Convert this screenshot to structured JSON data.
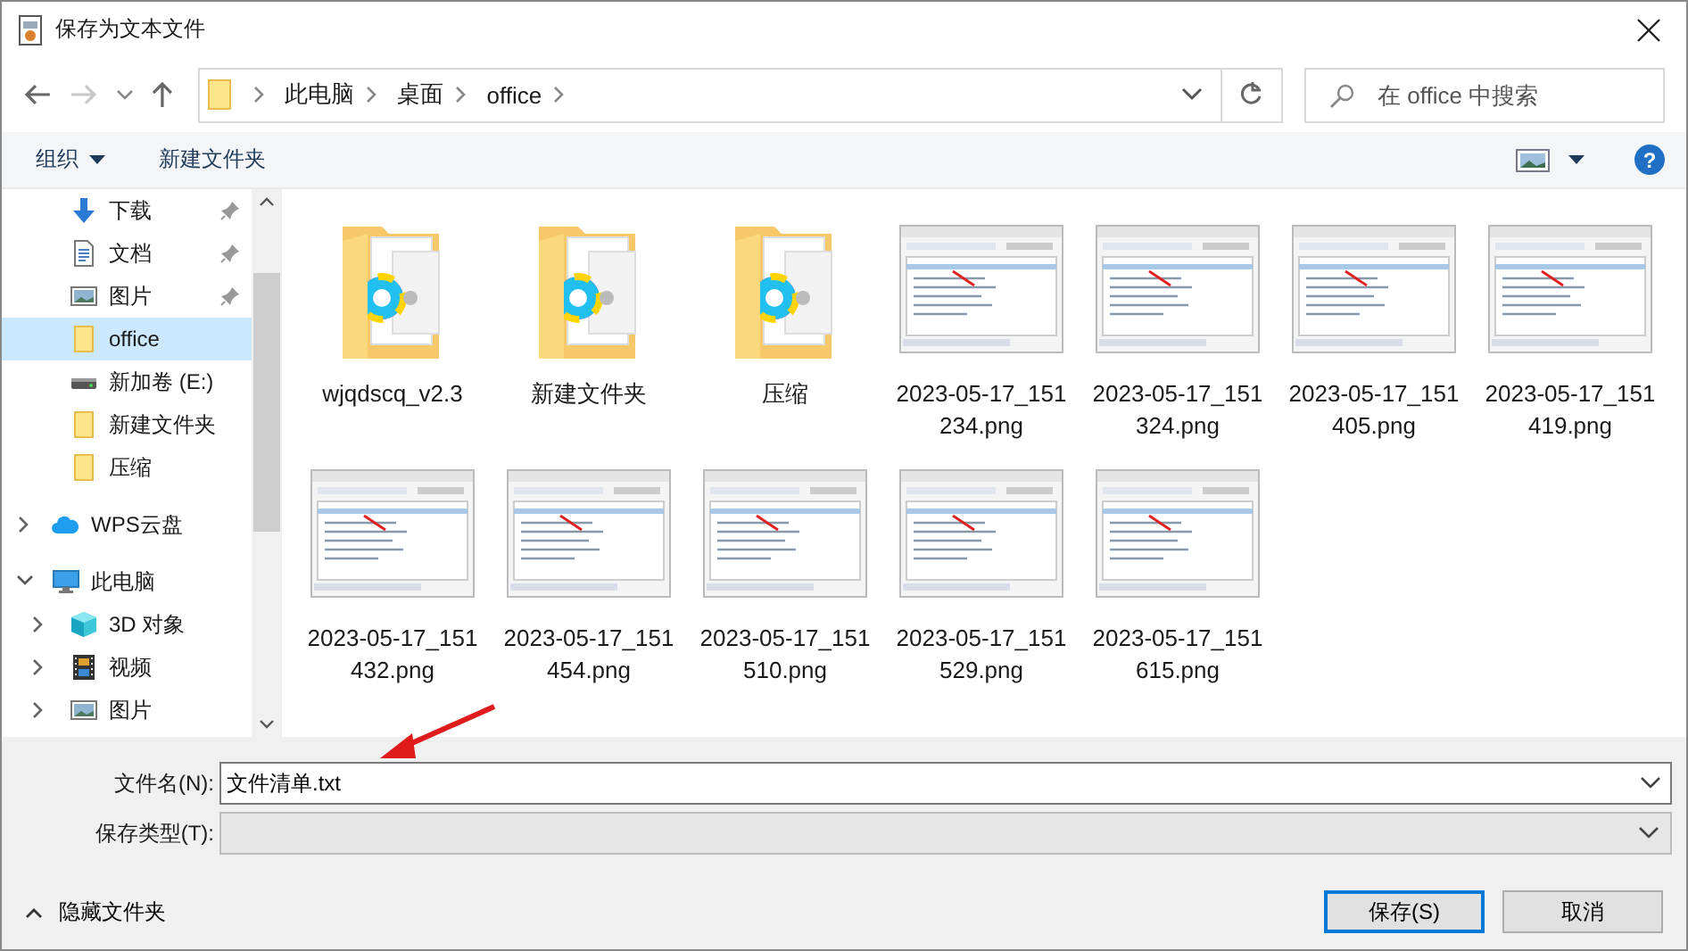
{
  "window": {
    "title": "保存为文本文件"
  },
  "navigation": {
    "back_disabled": false,
    "forward_disabled": true
  },
  "address": {
    "crumbs": [
      "此电脑",
      "桌面",
      "office"
    ]
  },
  "search": {
    "placeholder": "在 office 中搜索"
  },
  "toolbar": {
    "organize": "组织",
    "new_folder": "新建文件夹",
    "help": "?"
  },
  "sidebar": {
    "pinned_items": [
      {
        "label": "下载",
        "kind": "download",
        "pinned": true,
        "selected": false
      },
      {
        "label": "文档",
        "kind": "document",
        "pinned": true,
        "selected": false
      },
      {
        "label": "图片",
        "kind": "picture",
        "pinned": true,
        "selected": false
      },
      {
        "label": "office",
        "kind": "folder",
        "pinned": false,
        "selected": true
      },
      {
        "label": "新加卷 (E:)",
        "kind": "drive",
        "pinned": false,
        "selected": false
      },
      {
        "label": "新建文件夹",
        "kind": "folder",
        "pinned": false,
        "selected": false
      },
      {
        "label": "压缩",
        "kind": "folder",
        "pinned": false,
        "selected": false
      }
    ],
    "roots": [
      {
        "label": "WPS云盘",
        "kind": "cloud",
        "expanded": false,
        "selected": false
      },
      {
        "label": "此电脑",
        "kind": "monitor",
        "expanded": true,
        "selected": false,
        "children": [
          {
            "label": "3D 对象",
            "kind": "cube",
            "expanded": false,
            "selected": false
          },
          {
            "label": "视频",
            "kind": "film",
            "expanded": false,
            "selected": false
          },
          {
            "label": "图片",
            "kind": "picture",
            "expanded": false,
            "selected": false
          }
        ]
      }
    ]
  },
  "files": [
    {
      "name": "wjqdscq_v2.3",
      "kind": "folder"
    },
    {
      "name": "新建文件夹",
      "kind": "folder"
    },
    {
      "name": "压缩",
      "kind": "folder"
    },
    {
      "name": "2023-05-17_151234.png"
    },
    {
      "name": "2023-05-17_151324.png"
    },
    {
      "name": "2023-05-17_151405.png"
    },
    {
      "name": "2023-05-17_151419.png"
    },
    {
      "name": "2023-05-17_151432.png"
    },
    {
      "name": "2023-05-17_151454.png"
    },
    {
      "name": "2023-05-17_151510.png"
    },
    {
      "name": "2023-05-17_151529.png"
    },
    {
      "name": "2023-05-17_151615.png"
    }
  ],
  "form": {
    "filename_label": "文件名(N):",
    "filename": "文件清单.txt",
    "type_label": "保存类型(T):",
    "type_disabled": true
  },
  "footer": {
    "hide_folders": "隐藏文件夹",
    "buttons": [
      {
        "label": "保存(S)",
        "default": true
      },
      {
        "label": "取消",
        "default": false
      }
    ]
  }
}
